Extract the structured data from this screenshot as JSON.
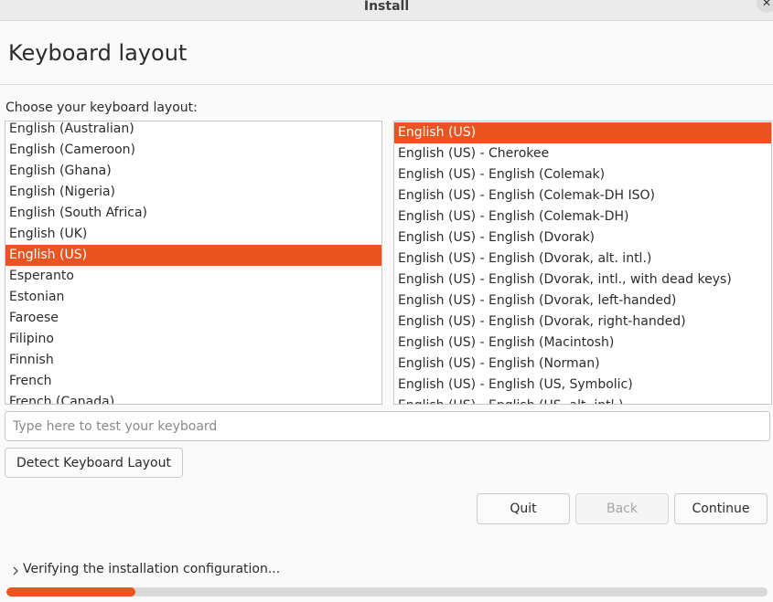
{
  "window": {
    "title": "Install",
    "close_icon": "close-icon"
  },
  "page": {
    "title": "Keyboard layout",
    "choose_label": "Choose your keyboard layout:"
  },
  "layouts": {
    "items": [
      "English (Australian)",
      "English (Cameroon)",
      "English (Ghana)",
      "English (Nigeria)",
      "English (South Africa)",
      "English (UK)",
      "English (US)",
      "Esperanto",
      "Estonian",
      "Faroese",
      "Filipino",
      "Finnish",
      "French",
      "French (Canada)"
    ],
    "selected": "English (US)"
  },
  "variants": {
    "items": [
      "English (US)",
      "English (US) - Cherokee",
      "English (US) - English (Colemak)",
      "English (US) - English (Colemak-DH ISO)",
      "English (US) - English (Colemak-DH)",
      "English (US) - English (Dvorak)",
      "English (US) - English (Dvorak, alt. intl.)",
      "English (US) - English (Dvorak, intl., with dead keys)",
      "English (US) - English (Dvorak, left-handed)",
      "English (US) - English (Dvorak, right-handed)",
      "English (US) - English (Macintosh)",
      "English (US) - English (Norman)",
      "English (US) - English (US, Symbolic)",
      "English (US) - English (US, alt. intl.)"
    ],
    "selected": "English (US)"
  },
  "test": {
    "placeholder": "Type here to test your keyboard",
    "value": ""
  },
  "buttons": {
    "detect": "Detect Keyboard Layout",
    "quit": "Quit",
    "back": "Back",
    "continue": "Continue"
  },
  "status": {
    "text": "Verifying the installation configuration...",
    "expander_icon": "chevron-right-icon",
    "progress": 0.17
  },
  "colors": {
    "accent": "#e95420"
  }
}
